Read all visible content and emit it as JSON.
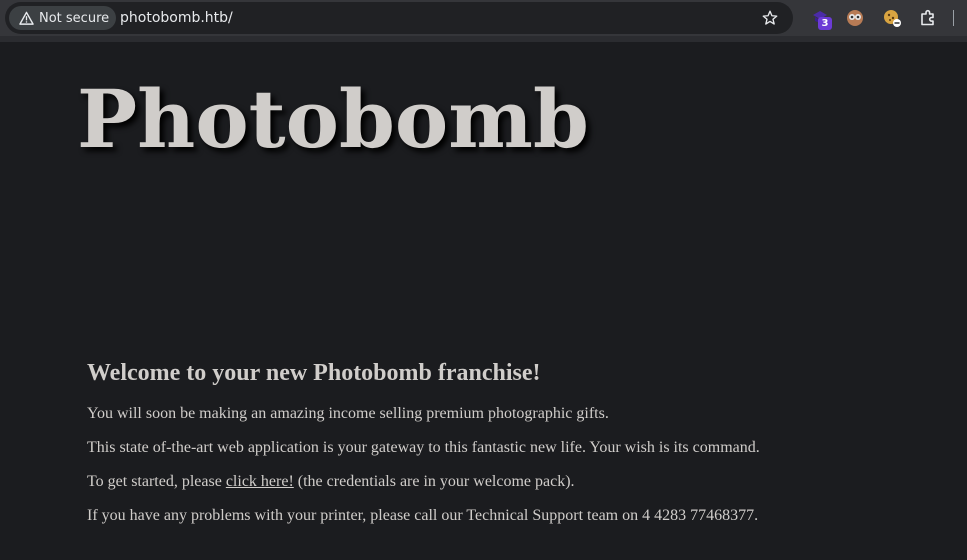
{
  "browser": {
    "security_label": "Not secure",
    "url": "photobomb.htb/",
    "extension_badge": "3"
  },
  "page": {
    "title": "Photobomb",
    "heading": "Welcome to your new Photobomb franchise!",
    "paragraph1": "You will soon be making an amazing income selling premium photographic gifts.",
    "paragraph2": "This state of-the-art web application is your gateway to this fantastic new life. Your wish is its command.",
    "paragraph3_before": "To get started, please ",
    "paragraph3_link": "click here!",
    "paragraph3_after": " (the credentials are in your welcome pack).",
    "paragraph4": "If you have any problems with your printer, please call our Technical Support team on 4 4283 77468377."
  },
  "colors": {
    "background": "#1b1c1f",
    "text": "#d0cdca",
    "toolbar": "#35363a"
  },
  "icons": [
    "warning-icon",
    "star-icon",
    "extension-icon",
    "puzzle-icon"
  ]
}
